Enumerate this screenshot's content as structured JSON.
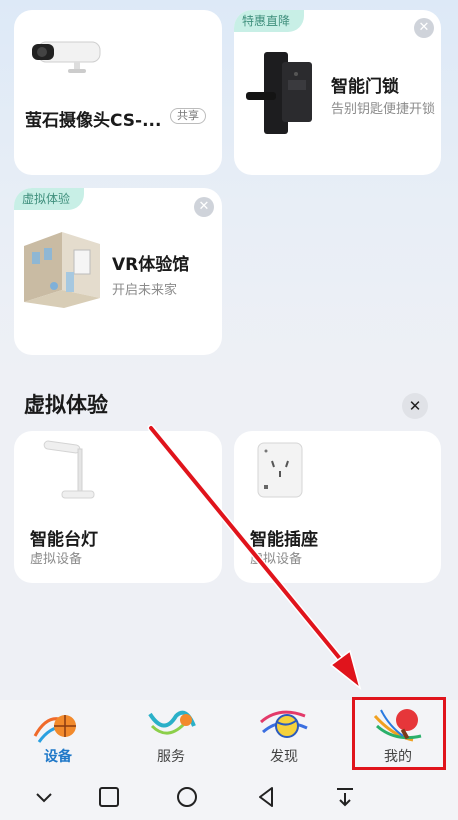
{
  "devices": {
    "camera": {
      "name": "萤石摄像头CS-...",
      "badge": "共享"
    },
    "door_lock": {
      "tag": "特惠直降",
      "name": "智能门锁",
      "subtitle": "告别钥匙便捷开锁"
    },
    "vr_hall": {
      "tag": "虚拟体验",
      "name": "VR体验馆",
      "subtitle": "开启未来家"
    }
  },
  "virtual_section": {
    "title": "虚拟体验",
    "close_symbol": "✕",
    "items": [
      {
        "name": "智能台灯",
        "subtitle": "虚拟设备"
      },
      {
        "name": "智能插座",
        "subtitle": "虚拟设备"
      }
    ]
  },
  "tabs": [
    {
      "label": "设备",
      "icon": "basketball-icon",
      "active": true
    },
    {
      "label": "服务",
      "icon": "ribbon-icon",
      "active": false
    },
    {
      "label": "发现",
      "icon": "volleyball-icon",
      "active": false
    },
    {
      "label": "我的",
      "icon": "pingpong-icon",
      "active": false
    }
  ],
  "system_nav": [
    "back-chevron",
    "recents-square",
    "home-circle",
    "back-triangle",
    "download-icon"
  ],
  "colors": {
    "accent": "#1f78c8",
    "tag_bg": "#c8efe6",
    "annotation_red": "#e0141c"
  }
}
